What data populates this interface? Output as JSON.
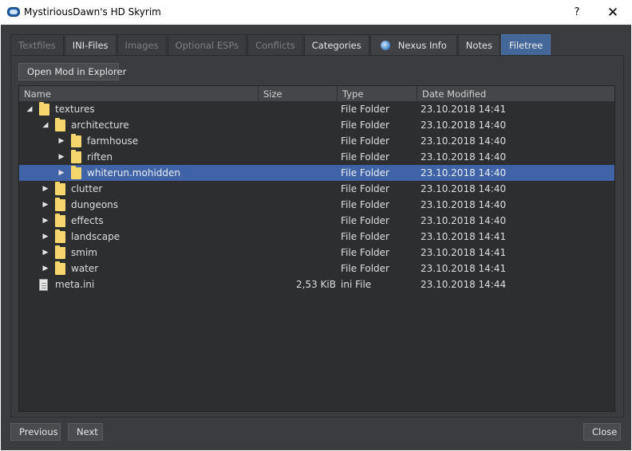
{
  "window": {
    "title": "MystiriousDawn's HD Skyrim",
    "help": "?",
    "close": "✕"
  },
  "tabs": [
    {
      "label": "Textfiles",
      "state": "disabled"
    },
    {
      "label": "INI-Files",
      "state": "enabled"
    },
    {
      "label": "Images",
      "state": "disabled"
    },
    {
      "label": "Optional ESPs",
      "state": "disabled"
    },
    {
      "label": "Conflicts",
      "state": "disabled"
    },
    {
      "label": "Categories",
      "state": "enabled"
    },
    {
      "label": "Nexus Info",
      "state": "enabled"
    },
    {
      "label": "Notes",
      "state": "enabled"
    },
    {
      "label": "Filetree",
      "state": "active"
    }
  ],
  "open_mod_button": "Open Mod in Explorer",
  "columns": {
    "name": "Name",
    "size": "Size",
    "type": "Type",
    "date": "Date Modified"
  },
  "rows": [
    {
      "name": "textures",
      "size": "",
      "type": "File Folder",
      "date": "23.10.2018 14:41",
      "expander": "expanded",
      "icon": "folder-icon",
      "depth": 0
    },
    {
      "name": "architecture",
      "size": "",
      "type": "File Folder",
      "date": "23.10.2018 14:40",
      "expander": "expanded",
      "icon": "folder-icon",
      "depth": 1
    },
    {
      "name": "farmhouse",
      "size": "",
      "type": "File Folder",
      "date": "23.10.2018 14:40",
      "expander": "collapsed",
      "icon": "folder-icon",
      "depth": 2
    },
    {
      "name": "riften",
      "size": "",
      "type": "File Folder",
      "date": "23.10.2018 14:40",
      "expander": "collapsed",
      "icon": "folder-icon",
      "depth": 2
    },
    {
      "name": "whiterun.mohidden",
      "size": "",
      "type": "File Folder",
      "date": "23.10.2018 14:40",
      "expander": "collapsed",
      "icon": "folder-icon",
      "depth": 2,
      "selected": true
    },
    {
      "name": "clutter",
      "size": "",
      "type": "File Folder",
      "date": "23.10.2018 14:40",
      "expander": "collapsed",
      "icon": "folder-icon",
      "depth": 1
    },
    {
      "name": "dungeons",
      "size": "",
      "type": "File Folder",
      "date": "23.10.2018 14:40",
      "expander": "collapsed",
      "icon": "folder-icon",
      "depth": 1
    },
    {
      "name": "effects",
      "size": "",
      "type": "File Folder",
      "date": "23.10.2018 14:40",
      "expander": "collapsed",
      "icon": "folder-icon",
      "depth": 1
    },
    {
      "name": "landscape",
      "size": "",
      "type": "File Folder",
      "date": "23.10.2018 14:41",
      "expander": "collapsed",
      "icon": "folder-icon",
      "depth": 1
    },
    {
      "name": "smim",
      "size": "",
      "type": "File Folder",
      "date": "23.10.2018 14:41",
      "expander": "collapsed",
      "icon": "folder-icon",
      "depth": 1
    },
    {
      "name": "water",
      "size": "",
      "type": "File Folder",
      "date": "23.10.2018 14:41",
      "expander": "collapsed",
      "icon": "folder-icon",
      "depth": 1
    },
    {
      "name": "meta.ini",
      "size": "2,53 KiB",
      "type": "ini File",
      "date": "23.10.2018 14:44",
      "expander": "none",
      "icon": "file-icon",
      "depth": 0
    }
  ],
  "footer": {
    "previous": "Previous",
    "next": "Next",
    "close": "Close"
  },
  "colors": {
    "background": "#3b3c3f",
    "selection": "#3f63a6",
    "active_tab": "#44679a",
    "folder": "#f7d66e"
  }
}
